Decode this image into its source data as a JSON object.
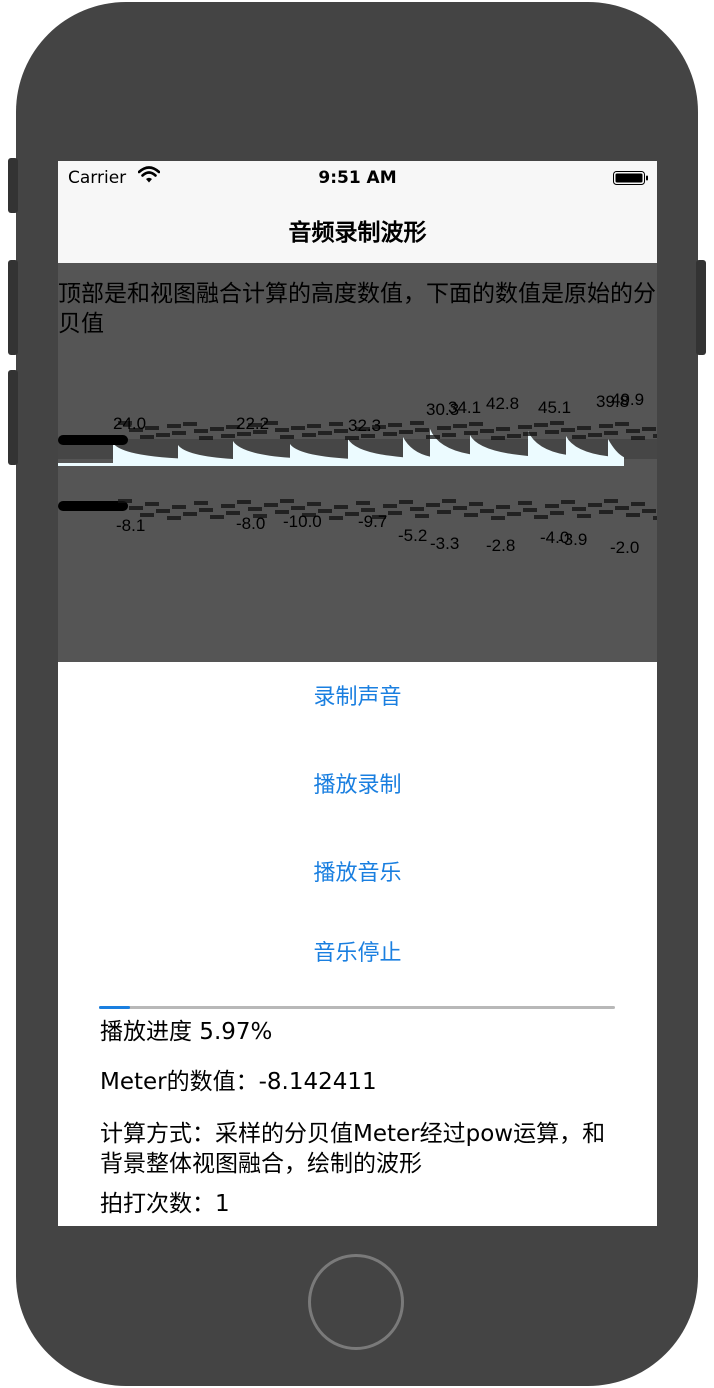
{
  "status_bar": {
    "carrier": "Carrier",
    "time": "9:51 AM"
  },
  "nav": {
    "title": "音频录制波形"
  },
  "waveform": {
    "description": "顶部是和视图融合计算的高度数值，下面的数值是原始的分贝值",
    "top_labels_visible": [
      "24.0",
      "22.2",
      "32.3",
      "30.3",
      "34.1",
      "42.8",
      "45.1",
      "39.8",
      "49.9"
    ],
    "bottom_labels_visible": [
      "-8.1",
      "-8.0",
      "-10.0",
      "-9.7",
      "-5.2",
      "-3.3",
      "-2.8",
      "-4.0",
      "-3.9",
      "-2.0"
    ],
    "wave_color": "#ecfbff",
    "panel_color": "#555555"
  },
  "actions": {
    "record": "录制声音",
    "play_recording": "播放录制",
    "play_music": "播放音乐",
    "stop_music": "音乐停止"
  },
  "progress": {
    "fraction": 0.0597,
    "label": "播放进度 5.97%"
  },
  "meter": {
    "label": "Meter的数值：-8.142411"
  },
  "calc": {
    "label": "计算方式：采样的分贝值Meter经过pow运算，和背景整体视图融合，绘制的波形"
  },
  "beats": {
    "label": "拍打次数：1"
  },
  "colors": {
    "accent": "#1a7fe0",
    "phone_body": "#444444"
  }
}
